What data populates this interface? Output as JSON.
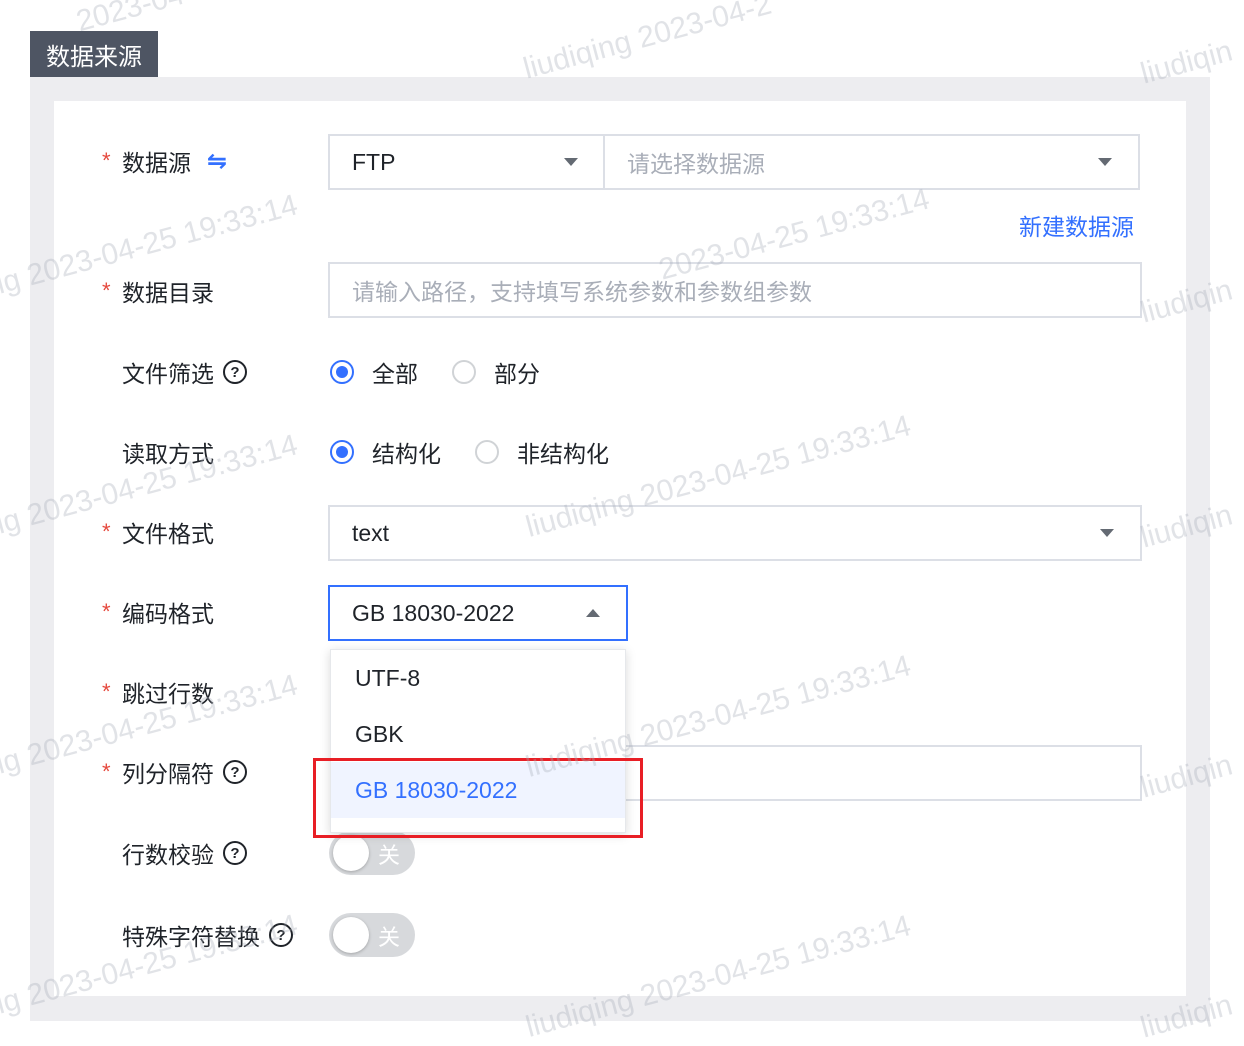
{
  "section_title": "数据来源",
  "form": {
    "data_source": {
      "label": "数据源",
      "swap_icon": "⇋",
      "type_value": "FTP",
      "source_placeholder": "请选择数据源",
      "new_link": "新建数据源"
    },
    "data_dir": {
      "label": "数据目录",
      "placeholder": "请输入路径，支持填写系统参数和参数组参数"
    },
    "file_filter": {
      "label": "文件筛选",
      "options": [
        "全部",
        "部分"
      ],
      "selected": "全部"
    },
    "read_mode": {
      "label": "读取方式",
      "options": [
        "结构化",
        "非结构化"
      ],
      "selected": "结构化"
    },
    "file_format": {
      "label": "文件格式",
      "value": "text"
    },
    "encoding": {
      "label": "编码格式",
      "value": "GB 18030-2022",
      "options": [
        "UTF-8",
        "GBK",
        "GB 18030-2022"
      ]
    },
    "skip_rows": {
      "label": "跳过行数"
    },
    "col_sep": {
      "label": "列分隔符"
    },
    "row_check": {
      "label": "行数校验",
      "switch_text": "关",
      "on": false
    },
    "special_replace": {
      "label": "特殊字符替换",
      "switch_text": "关",
      "on": false
    },
    "required_mark": "*",
    "help_mark": "?"
  },
  "watermark": {
    "user": "liudiqing",
    "timestamp": "2023-04-25 19:33:14",
    "fragments": [
      "2023-04-2",
      "liudiqing 2023-04-2",
      "liudiqin",
      "ig 2023-04-25 19:33:14",
      "2023-04-25 19:33:14",
      "liudiqing 2023-04-25 19:33:14"
    ]
  },
  "colors": {
    "accent": "#3370ff",
    "required": "#e5483d",
    "highlight": "#e81e25",
    "tab_bg": "#4e5563"
  }
}
